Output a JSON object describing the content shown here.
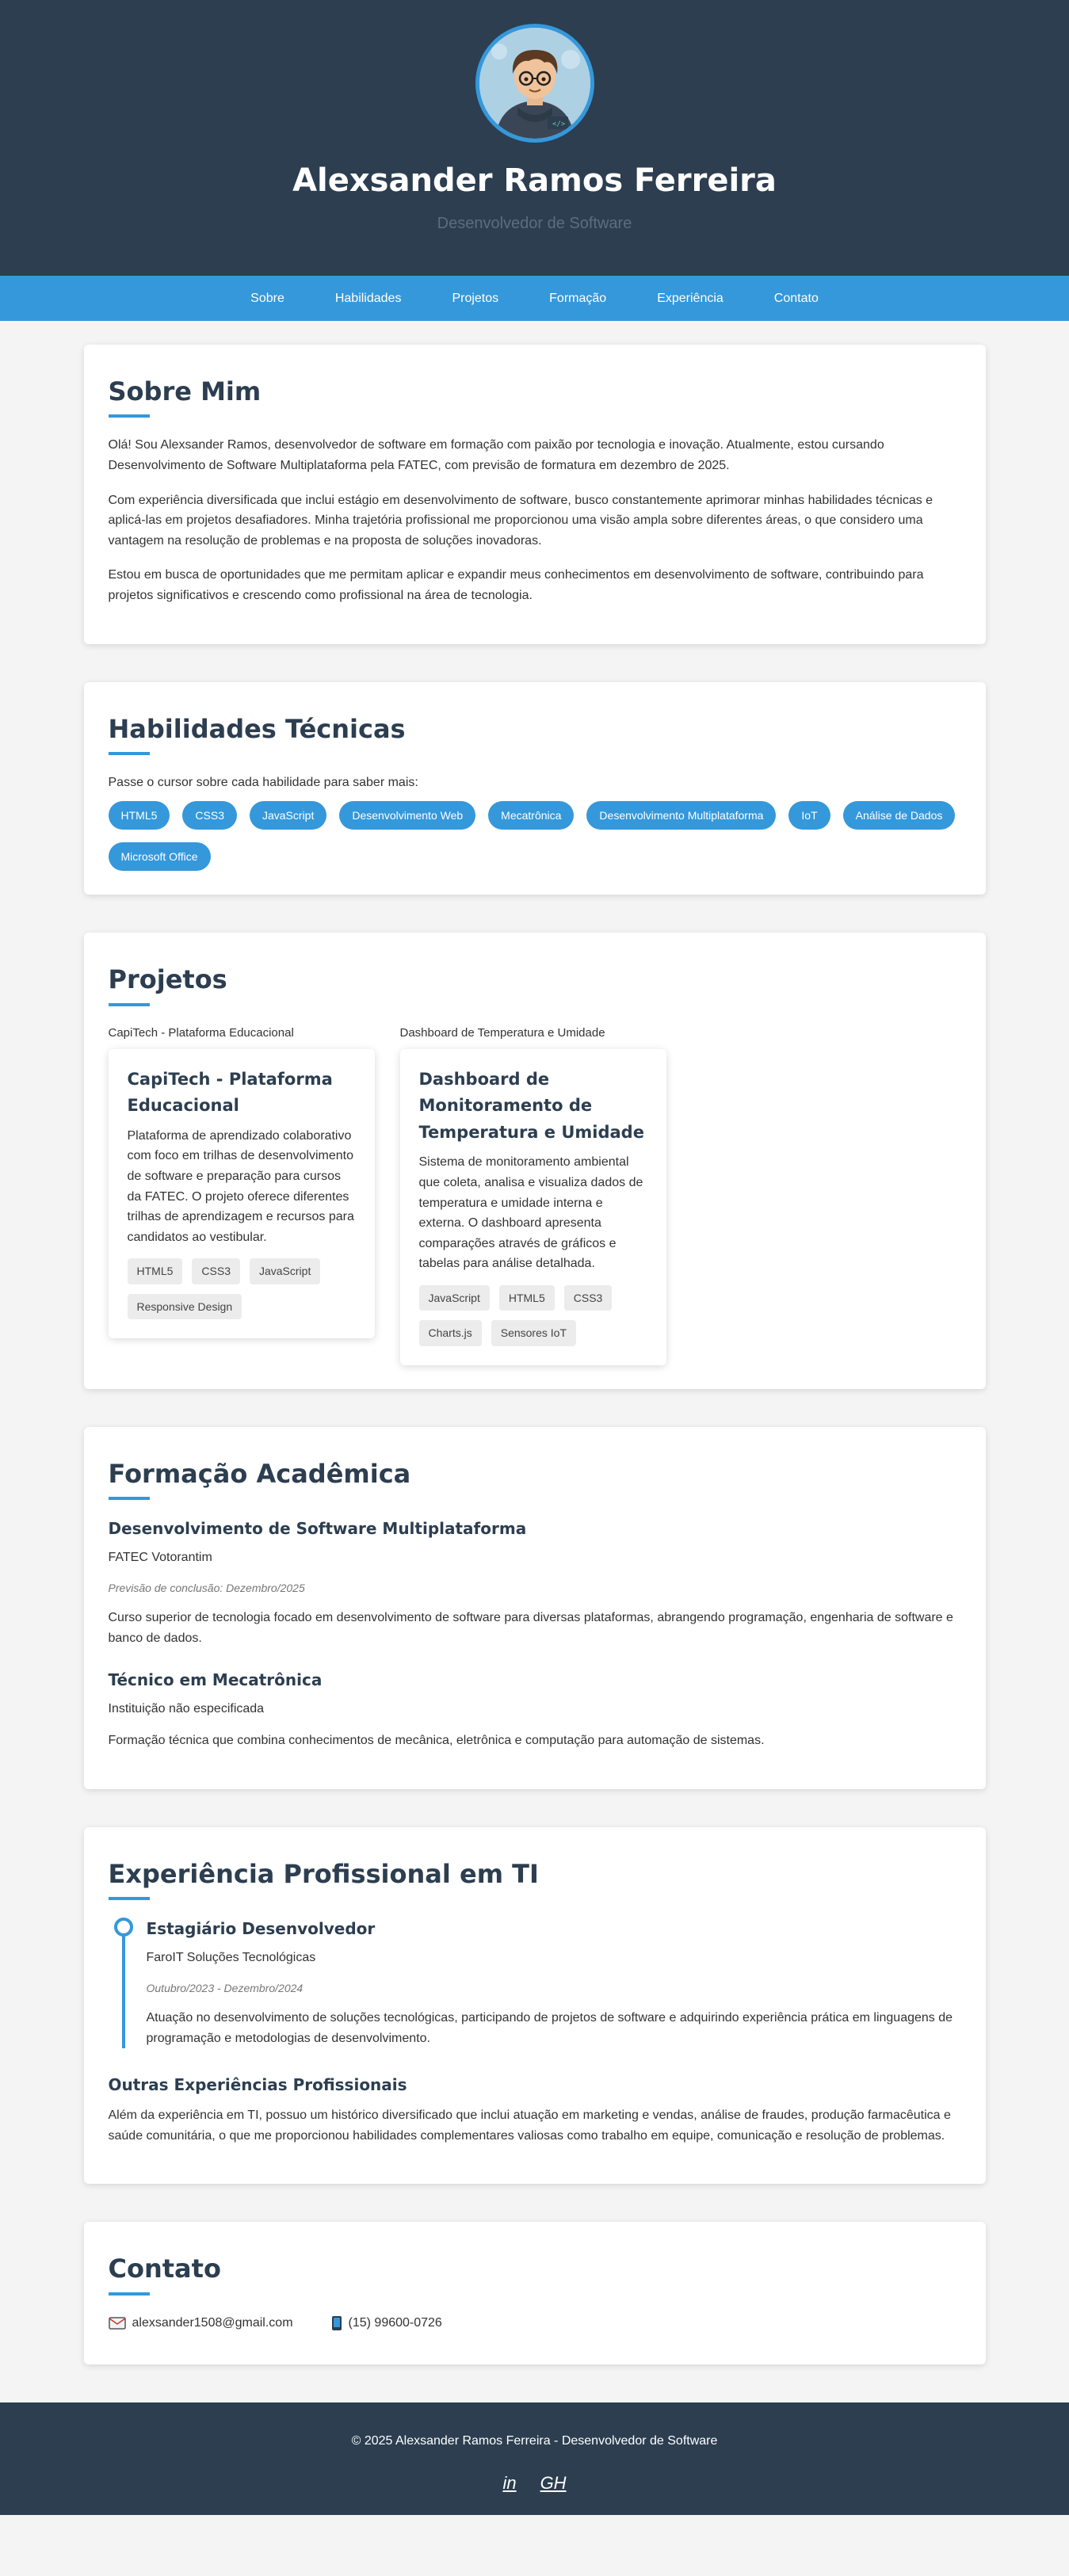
{
  "header": {
    "name": "Alexsander Ramos Ferreira",
    "subtitle": "Desenvolvedor de Software"
  },
  "nav": {
    "items": [
      "Sobre",
      "Habilidades",
      "Projetos",
      "Formação",
      "Experiência",
      "Contato"
    ]
  },
  "about": {
    "title": "Sobre Mim",
    "paragraphs": [
      "Olá! Sou Alexsander Ramos, desenvolvedor de software em formação com paixão por tecnologia e inovação. Atualmente, estou cursando Desenvolvimento de Software Multiplataforma pela FATEC, com previsão de formatura em dezembro de 2025.",
      "Com experiência diversificada que inclui estágio em desenvolvimento de software, busco constantemente aprimorar minhas habilidades técnicas e aplicá-las em projetos desafiadores. Minha trajetória profissional me proporcionou uma visão ampla sobre diferentes áreas, o que considero uma vantagem na resolução de problemas e na proposta de soluções inovadoras.",
      "Estou em busca de oportunidades que me permitam aplicar e expandir meus conhecimentos em desenvolvimento de software, contribuindo para projetos significativos e crescendo como profissional na área de tecnologia."
    ]
  },
  "skills": {
    "title": "Habilidades Técnicas",
    "hint": "Passe o cursor sobre cada habilidade para saber mais:",
    "items": [
      "HTML5",
      "CSS3",
      "JavaScript",
      "Desenvolvimento Web",
      "Mecatrônica",
      "Desenvolvimento Multiplataforma",
      "IoT",
      "Análise de Dados",
      "Microsoft Office"
    ]
  },
  "projects": {
    "title": "Projetos",
    "items": [
      {
        "caption": "CapiTech - Plataforma Educacional",
        "title": "CapiTech - Plataforma Educacional",
        "description": "Plataforma de aprendizado colaborativo com foco em trilhas de desenvolvimento de software e preparação para cursos da FATEC. O projeto oferece diferentes trilhas de aprendizagem e recursos para candidatos ao vestibular.",
        "tags": [
          "HTML5",
          "CSS3",
          "JavaScript",
          "Responsive Design"
        ]
      },
      {
        "caption": "Dashboard de Temperatura e Umidade",
        "title": "Dashboard de Monitoramento de Temperatura e Umidade",
        "description": "Sistema de monitoramento ambiental que coleta, analisa e visualiza dados de temperatura e umidade interna e externa. O dashboard apresenta comparações através de gráficos e tabelas para análise detalhada.",
        "tags": [
          "JavaScript",
          "HTML5",
          "CSS3",
          "Charts.js",
          "Sensores IoT"
        ]
      }
    ]
  },
  "education": {
    "title": "Formação Acadêmica",
    "items": [
      {
        "degree": "Desenvolvimento de Software Multiplataforma",
        "institution": "FATEC Votorantim",
        "date": "Previsão de conclusão: Dezembro/2025",
        "description": "Curso superior de tecnologia focado em desenvolvimento de software para diversas plataformas, abrangendo programação, engenharia de software e banco de dados."
      },
      {
        "degree": "Técnico em Mecatrônica",
        "institution": "Instituição não especificada",
        "date": "",
        "description": "Formação técnica que combina conhecimentos de mecânica, eletrônica e computação para automação de sistemas."
      }
    ]
  },
  "experience": {
    "title": "Experiência Profissional em TI",
    "job": {
      "role": "Estagiário Desenvolvedor",
      "company": "FaroIT Soluções Tecnológicas",
      "period": "Outubro/2023 - Dezembro/2024",
      "description": "Atuação no desenvolvimento de soluções tecnológicas, participando de projetos de software e adquirindo experiência prática em linguagens de programação e metodologias de desenvolvimento."
    },
    "other_title": "Outras Experiências Profissionais",
    "other_text": "Além da experiência em TI, possuo um histórico diversificado que inclui atuação em marketing e vendas, análise de fraudes, produção farmacêutica e saúde comunitária, o que me proporcionou habilidades complementares valiosas como trabalho em equipe, comunicação e resolução de problemas."
  },
  "contact": {
    "title": "Contato",
    "email": "alexsander1508@gmail.com",
    "phone": "(15) 99600-0726",
    "email_icon": "email-icon",
    "phone_icon": "phone-icon"
  },
  "footer": {
    "copyright": "© 2025 Alexsander Ramos Ferreira - Desenvolvedor de Software",
    "social": [
      "in",
      "GH"
    ]
  },
  "colors": {
    "header_bg": "#2c3e50",
    "accent": "#3498db",
    "page_bg": "#f4f4f4"
  }
}
